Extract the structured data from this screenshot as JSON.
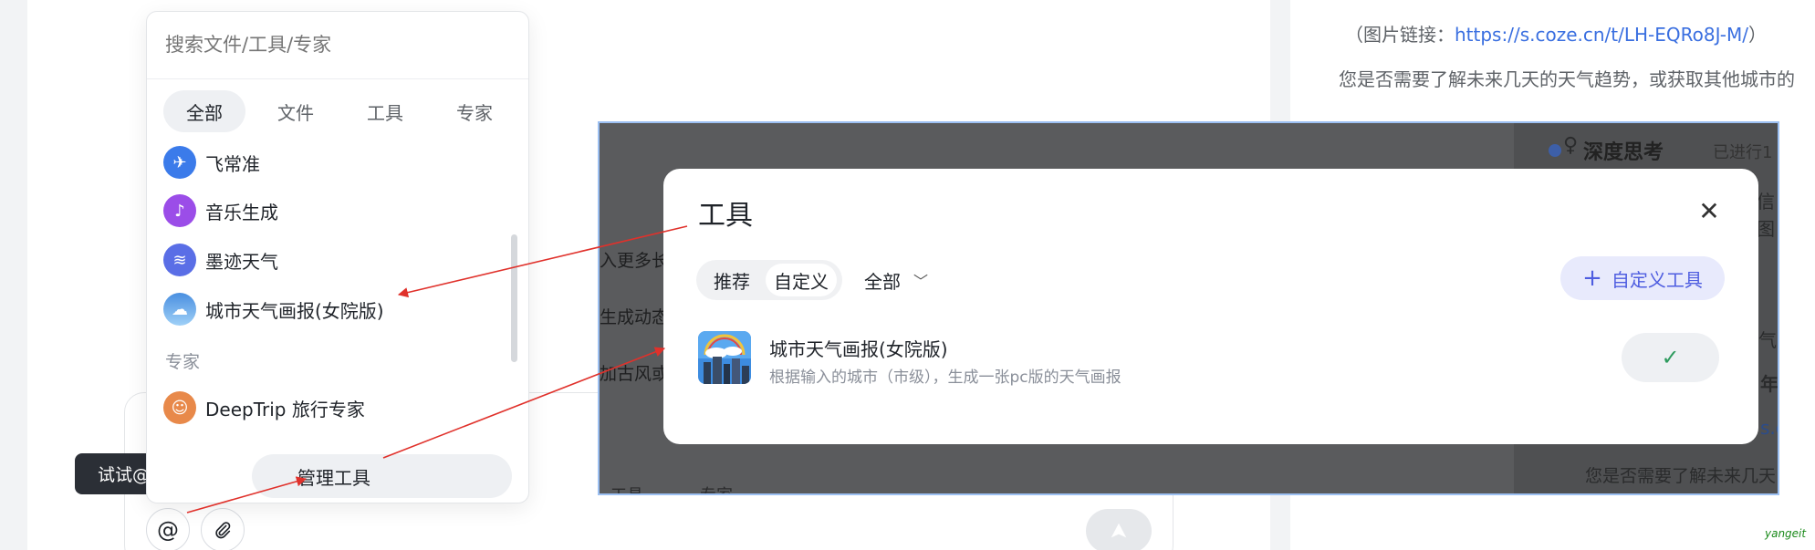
{
  "right_panel": {
    "link_prefix": "（图片链接：",
    "link_url": "https://s.coze.cn/t/LH-EQRo8J-M/",
    "link_suffix": "）",
    "question": "您是否需要了解未来几天的天气趋势，或获取其他城市的"
  },
  "mention_popup": {
    "search_placeholder": "搜索文件/工具/专家",
    "tabs": [
      "全部",
      "文件",
      "工具",
      "专家"
    ],
    "tools": [
      "飞常准",
      "音乐生成",
      "墨迹天气",
      "城市天气画报(女院版)"
    ],
    "experts_label": "专家",
    "experts": [
      "DeepTrip 旅行专家"
    ],
    "manage_label": "管理工具"
  },
  "tooltip": "试试@专家和工具",
  "input_bar": {
    "at_icon": "@",
    "attach_icon": "paperclip-icon",
    "send_icon": "send-icon"
  },
  "overlay": {
    "think_title": "深度思考",
    "think_status": "已进行1",
    "bottom_text": "您是否需要了解未来几天",
    "left_snippets": [
      "入更多长",
      "生成动态",
      "加古风或"
    ],
    "bottom_snippets": [
      "工具",
      "专家"
    ],
    "right_snippets": [
      "信",
      "图",
      "气",
      "年",
      "s.c"
    ]
  },
  "tools_modal": {
    "title": "工具",
    "close_icon": "close-icon",
    "tabs": [
      "推荐",
      "自定义"
    ],
    "filter": "全部",
    "custom_button": "自定义工具",
    "tool": {
      "name": "城市天气画报(女院版)",
      "desc": "根据输入的城市（市级），生成一张pc版的天气画报",
      "status_icon": "check-icon"
    }
  },
  "watermark": "yangeit",
  "colors": {
    "accent": "#4e5de0",
    "arrow": "#e0312b",
    "link": "#3a6fe0",
    "check": "#2e9b5e"
  }
}
